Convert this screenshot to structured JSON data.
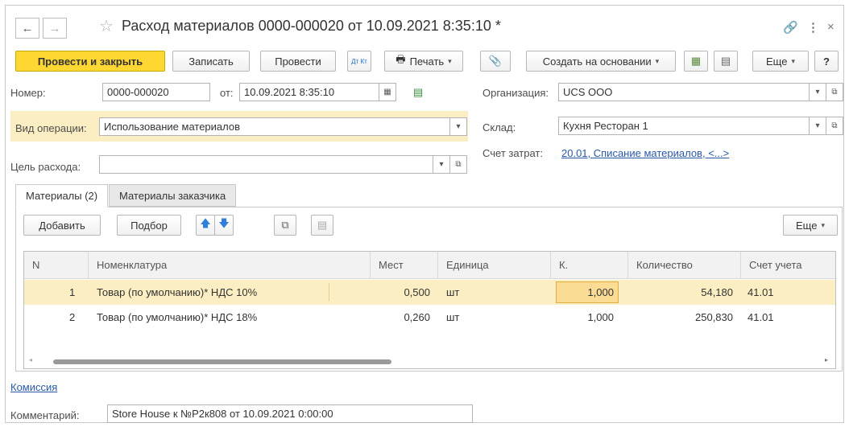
{
  "window": {
    "title": "Расход материалов 0000-000020 от 10.09.2021 8:35:10 *"
  },
  "toolbar": {
    "post_close": "Провести и закрыть",
    "save": "Записать",
    "post": "Провести",
    "dtkt": "Дт Кт",
    "print": "Печать",
    "create_based": "Создать на основании",
    "more": "Еще",
    "help": "?"
  },
  "header": {
    "number_label": "Номер:",
    "number_value": "0000-000020",
    "from_label": "от:",
    "date_value": "10.09.2021  8:35:10",
    "org_label": "Организация:",
    "org_value": "UCS ООО",
    "optype_label": "Вид операции:",
    "optype_value": "Использование материалов",
    "warehouse_label": "Склад:",
    "warehouse_value": "Кухня Ресторан 1",
    "cost_account_label": "Счет затрат:",
    "cost_account_value": "20.01, Списание материалов, <...>",
    "purpose_label": "Цель расхода:",
    "purpose_value": ""
  },
  "tabs": [
    {
      "label": "Материалы (2)"
    },
    {
      "label": "Материалы заказчика"
    }
  ],
  "table_toolbar": {
    "add": "Добавить",
    "select": "Подбор",
    "more": "Еще"
  },
  "table": {
    "columns": [
      "N",
      "Номенклатура",
      "Мест",
      "Единица",
      "К.",
      "Количество",
      "Счет учета"
    ],
    "rows": [
      {
        "n": "1",
        "item": "Товар (по умолчанию)* НДС 10%",
        "places": "0,500",
        "unit": "шт",
        "k": "1,000",
        "qty": "54,180",
        "account": "41.01"
      },
      {
        "n": "2",
        "item": "Товар (по умолчанию)* НДС 18%",
        "places": "0,260",
        "unit": "шт",
        "k": "1,000",
        "qty": "250,830",
        "account": "41.01"
      }
    ]
  },
  "footer": {
    "commission": "Комиссия",
    "comment_label": "Комментарий:",
    "comment_value": "Store House к №Р2к808 от 10.09.2021 0:00:00"
  },
  "colors": {
    "primary": "#ffd732",
    "highlight": "#fbeec2",
    "link": "#2a58a8"
  }
}
